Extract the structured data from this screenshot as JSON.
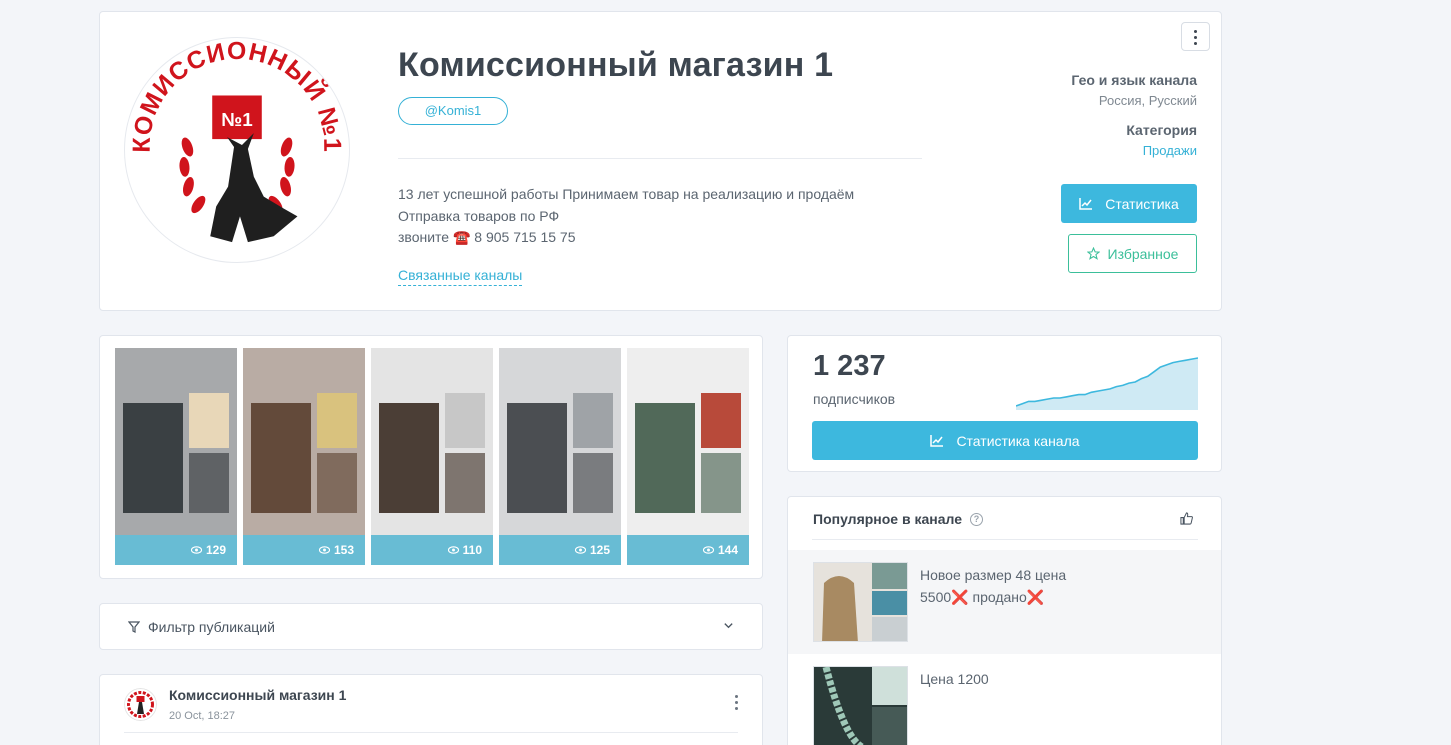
{
  "channel": {
    "title": "Комиссионный магазин 1",
    "handle": "@Komis1",
    "description_lines": [
      "13 лет успешной работы Принимаем товар на реализацию и продаём",
      "Отправка товаров по РФ",
      "звоните ☎️ 8 905 715 15 75"
    ],
    "linked_channels_label": "Связанные каналы",
    "logo_text": "КОМИССИОННЫЙ №1",
    "logo_badge": "№1"
  },
  "meta": {
    "geo_label": "Гео и язык канала",
    "geo_value": "Россия, Русский",
    "category_label": "Категория",
    "category_value": "Продажи"
  },
  "buttons": {
    "stats": "Статистика",
    "favorite": "Избранное",
    "channel_stats": "Статистика канала"
  },
  "gallery": [
    {
      "views": "129",
      "palette": [
        "#a7a9ab",
        "#2f3437",
        "#e8d7b8"
      ]
    },
    {
      "views": "153",
      "palette": [
        "#b9aca4",
        "#5a3f2f",
        "#d9c27e"
      ]
    },
    {
      "views": "110",
      "palette": [
        "#e4e4e4",
        "#3a2b22",
        "#c7c7c7"
      ]
    },
    {
      "views": "125",
      "palette": [
        "#d6d7d9",
        "#3c3f42",
        "#9fa3a7"
      ]
    },
    {
      "views": "144",
      "palette": [
        "#eeeeee",
        "#3f5a48",
        "#b84a3a"
      ]
    }
  ],
  "filter": {
    "label": "Фильтр публикаций"
  },
  "post": {
    "author": "Комиссионный магазин 1",
    "date": "20 Oct, 18:27"
  },
  "subscribers": {
    "count": "1 237",
    "label": "подписчиков",
    "trend": [
      10,
      12,
      14,
      14,
      15,
      16,
      17,
      17,
      18,
      19,
      20,
      20,
      22,
      23,
      24,
      25,
      27,
      28,
      30,
      31,
      34,
      36,
      40,
      44,
      46,
      48,
      49,
      50,
      51,
      52
    ]
  },
  "popular": {
    "title": "Популярное в канале",
    "items": [
      {
        "line1": "Новое размер 48 цена",
        "line2_price": "5500",
        "x1": "❌",
        "line2_status": "продано",
        "x2": "❌"
      },
      {
        "line1": "Цена 1200"
      }
    ]
  },
  "colors": {
    "accent": "#3db8de",
    "favorite": "#3bbf9a",
    "views_bar": "#68bcd4",
    "logo_red": "#d0141c"
  }
}
